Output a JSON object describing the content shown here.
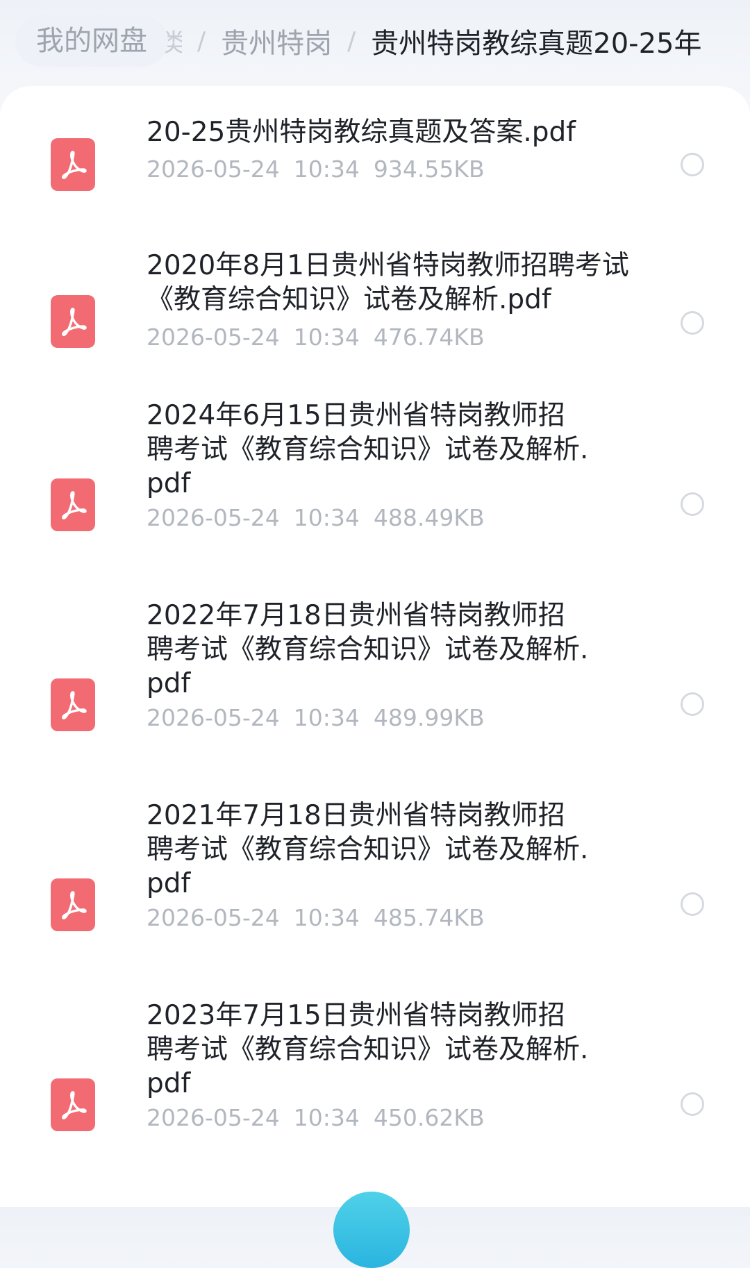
{
  "breadcrumb": {
    "root": "我的网盘",
    "hidden_fragment": "类",
    "separator": "/",
    "parent": "贵州特岗",
    "current": "贵州特岗教综真题20-25年"
  },
  "files": [
    {
      "name": "20-25贵州特岗教综真题及答案.pdf",
      "date": "2026-05-24",
      "time": "10:34",
      "size": "934.55KB",
      "icon": "pdf-icon"
    },
    {
      "name": "2020年8月1日贵州省特岗教师招聘考试《教育综合知识》试卷及解析.pdf",
      "date": "2026-05-24",
      "time": "10:34",
      "size": "476.74KB",
      "icon": "pdf-icon"
    },
    {
      "name": "2024年6月15日贵州省特岗教师招聘考试《教育综合知识》试卷及解析.pdf",
      "date": "2026-05-24",
      "time": "10:34",
      "size": "488.49KB",
      "icon": "pdf-icon"
    },
    {
      "name": "2022年7月18日贵州省特岗教师招聘考试《教育综合知识》试卷及解析.pdf",
      "date": "2026-05-24",
      "time": "10:34",
      "size": "489.99KB",
      "icon": "pdf-icon"
    },
    {
      "name": "2021年7月18日贵州省特岗教师招聘考试《教育综合知识》试卷及解析.pdf",
      "date": "2026-05-24",
      "time": "10:34",
      "size": "485.74KB",
      "icon": "pdf-icon"
    },
    {
      "name": "2023年7月15日贵州省特岗教师招聘考试《教育综合知识》试卷及解析.pdf",
      "date": "2026-05-24",
      "time": "10:34",
      "size": "450.62KB",
      "icon": "pdf-icon"
    }
  ],
  "colors": {
    "pdf_icon_bg": "#f26b73",
    "text_primary": "#1f2329",
    "text_secondary": "#b2b7bf",
    "fab": "#2ab4e0"
  }
}
